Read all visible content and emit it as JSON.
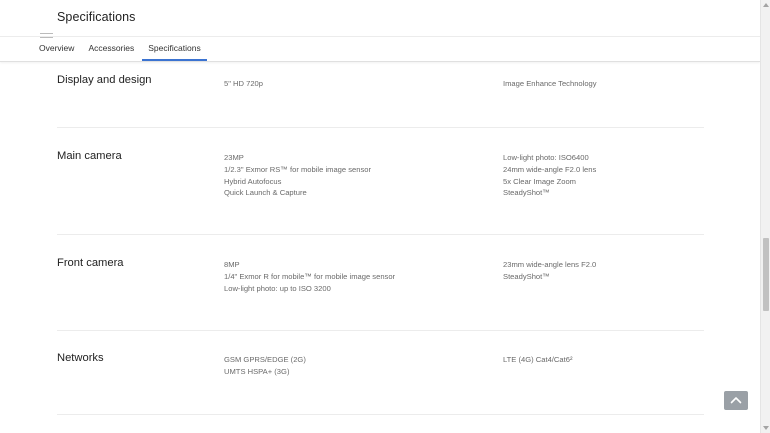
{
  "header": {
    "title": "Specifications",
    "tabs": [
      {
        "label": "Overview",
        "active": false
      },
      {
        "label": "Accessories",
        "active": false
      },
      {
        "label": "Specifications",
        "active": true
      }
    ]
  },
  "colors": {
    "active_tab_underline": "#3b73d1",
    "back_to_top_bg": "#9aa0a6",
    "spec_text": "#6a6a6a"
  },
  "sections": [
    {
      "title": "Display and design",
      "col_a": [
        "5\" HD 720p"
      ],
      "col_b": [
        "Image Enhance Technology"
      ]
    },
    {
      "title": "Main camera",
      "col_a": [
        "23MP",
        "1/2.3\" Exmor RS™ for mobile image sensor",
        "Hybrid Autofocus",
        "Quick Launch & Capture"
      ],
      "col_b": [
        "Low-light photo: ISO6400",
        "24mm wide-angle F2.0 lens",
        "5x Clear Image Zoom",
        "SteadyShot™"
      ]
    },
    {
      "title": "Front camera",
      "col_a": [
        "8MP",
        "1/4\" Exmor R for mobile™ for mobile image sensor",
        "Low-light photo: up to ISO 3200"
      ],
      "col_b": [
        "23mm wide-angle lens F2.0",
        "SteadyShot™"
      ]
    },
    {
      "title": "Networks",
      "col_a": [
        "GSM GPRS/EDGE (2G)",
        "UMTS HSPA+ (3G)"
      ],
      "col_b": [
        "LTE (4G) Cat4/Cat6²"
      ]
    }
  ],
  "icons": {
    "back_to_top": "chevron-up-icon",
    "menu": "menu-icon"
  }
}
